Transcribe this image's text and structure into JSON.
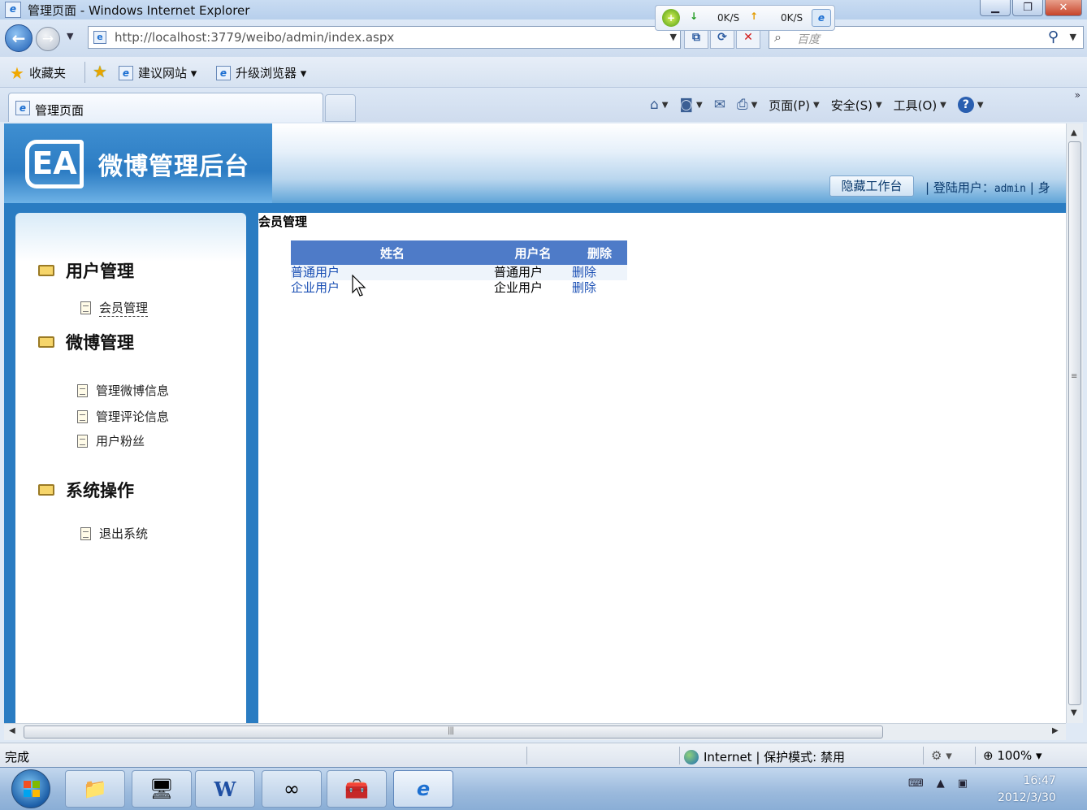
{
  "window": {
    "title": "管理页面 - Windows Internet Explorer",
    "min": "▁",
    "max": "❐",
    "close": "✕"
  },
  "speed": {
    "down_label": "↓",
    "down_value": "0K/S",
    "up_label": "↑",
    "up_value": "0K/S"
  },
  "address": {
    "url": "http://localhost:3779/weibo/admin/index.aspx",
    "search_placeholder": "百度"
  },
  "favorites": {
    "label": "收藏夹",
    "items": [
      "建议网站 ▾",
      "升级浏览器 ▾"
    ]
  },
  "tabs": {
    "active": "管理页面"
  },
  "commands": {
    "page": "页面(P)",
    "safety": "安全(S)",
    "tools": "工具(O)",
    "help": "?"
  },
  "site": {
    "logo": "EA",
    "title": "微博管理后台",
    "hide_button": "隐藏工作台",
    "login_label": "| 登陆用户：",
    "login_user": "admin",
    "login_suffix": "| 身"
  },
  "sidebar": {
    "groups": [
      {
        "title": "用户管理",
        "items": [
          "会员管理"
        ]
      },
      {
        "title": "微博管理",
        "items": [
          "管理微博信息",
          "管理评论信息",
          "用户粉丝"
        ]
      },
      {
        "title": "系统操作",
        "items": [
          "退出系统"
        ]
      }
    ]
  },
  "content": {
    "title": "会员管理",
    "columns": [
      "姓名",
      "用户名",
      "删除"
    ],
    "rows": [
      {
        "name": "普通用户",
        "username": "普通用户",
        "action": "删除"
      },
      {
        "name": "企业用户",
        "username": "企业用户",
        "action": "删除"
      }
    ]
  },
  "status": {
    "done": "完成",
    "zone": "Internet | 保护模式: 禁用",
    "zoom": "100%"
  },
  "clock": {
    "time": "16:47",
    "date": "2012/3/30"
  }
}
